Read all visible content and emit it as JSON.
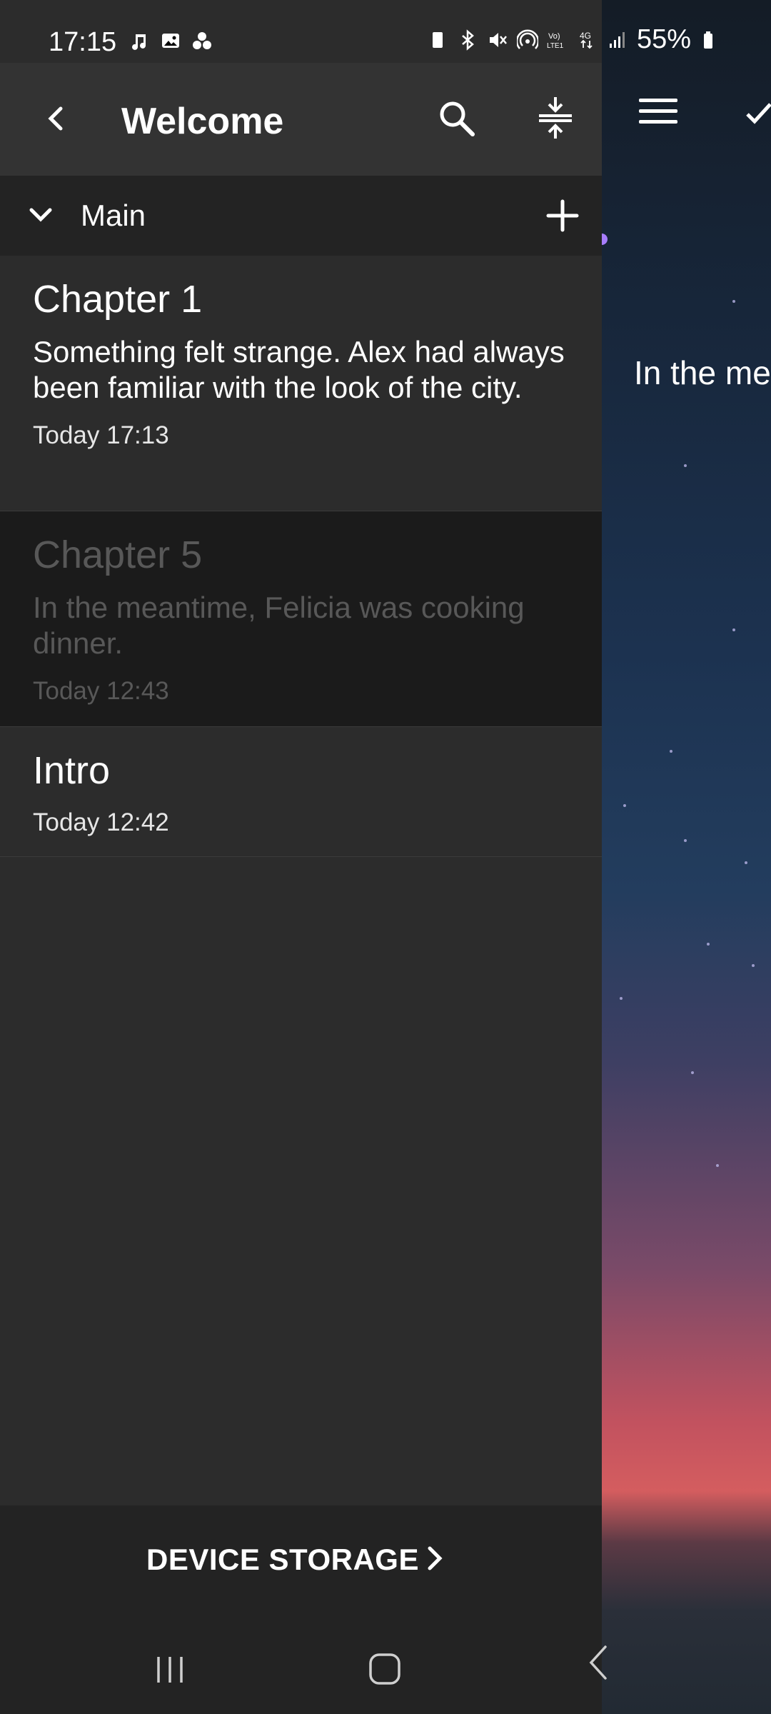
{
  "status_bar": {
    "time": "17:15",
    "battery": "55%",
    "left_icons": [
      "music-icon",
      "image-icon",
      "dots-icon"
    ],
    "right_icons": [
      "battery-saver-icon",
      "bluetooth-icon",
      "mute-icon",
      "hotspot-icon",
      "volte-icon",
      "4g-icon",
      "signal-icon",
      "battery-icon"
    ]
  },
  "app_bar": {
    "title": "Welcome",
    "back_icon": "back-icon",
    "search_icon": "search-icon",
    "collapse_icon": "collapse-icon"
  },
  "folder": {
    "name": "Main",
    "chevron_icon": "chevron-down-icon",
    "add_icon": "plus-icon"
  },
  "notes": [
    {
      "title": "Chapter 1",
      "body": "Something felt strange. Alex had always been familiar with the look of the city.",
      "time": "Today 17:13",
      "dimmed": false
    },
    {
      "title": "Chapter 5",
      "body": "In the meantime, Felicia was cooking dinner.",
      "time": "Today 12:43",
      "dimmed": true
    },
    {
      "title": "Intro",
      "body": "",
      "time": "Today 12:42",
      "dimmed": false
    }
  ],
  "storage": {
    "label": "DEVICE STORAGE"
  },
  "background_editor": {
    "preview_text": "In the me"
  },
  "nav_bar": {
    "icons": [
      "recents-icon",
      "home-icon",
      "back-icon"
    ]
  },
  "colors": {
    "drawer_bg": "#2c2c2c",
    "app_bar_bg": "#333333",
    "header_bg": "#232323",
    "dimmed_row_bg": "#1b1b1b",
    "accent_handle": "#a77dfc"
  }
}
